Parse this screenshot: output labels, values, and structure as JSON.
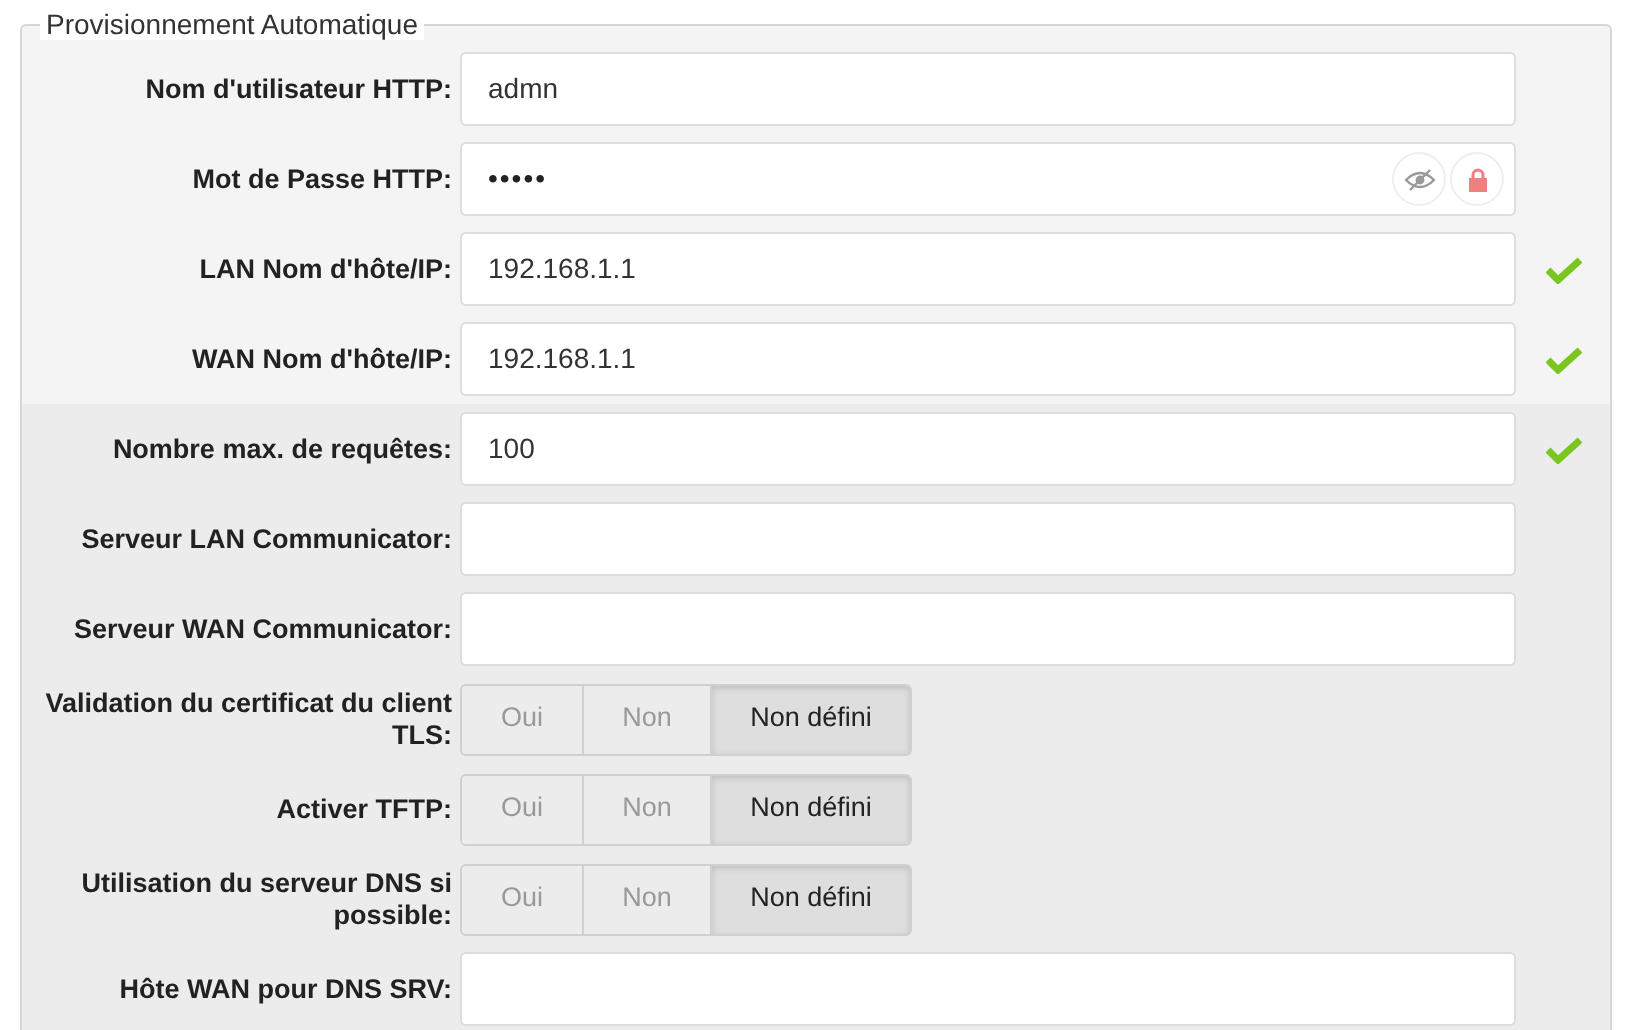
{
  "legend": "Provisionnement Automatique",
  "rows": [
    {
      "kind": "text",
      "label": "Nom d'utilisateur HTTP:",
      "value": "admn",
      "valid": false,
      "highlighted": false
    },
    {
      "kind": "password",
      "label": "Mot de Passe HTTP:",
      "value": "•••••",
      "valid": false,
      "highlighted": false
    },
    {
      "kind": "text",
      "label": "LAN Nom d'hôte/IP:",
      "value": "192.168.1.1",
      "valid": true,
      "highlighted": false
    },
    {
      "kind": "text",
      "label": "WAN Nom d'hôte/IP:",
      "value": "192.168.1.1",
      "valid": true,
      "highlighted": false
    },
    {
      "kind": "text",
      "label": "Nombre max. de requêtes:",
      "value": "100",
      "valid": true,
      "highlighted": true
    },
    {
      "kind": "text",
      "label": "Serveur LAN Communicator:",
      "valid": false,
      "highlighted": true
    },
    {
      "kind": "text",
      "label": "Serveur WAN Communicator:",
      "valid": false,
      "highlighted": true
    },
    {
      "kind": "toggle",
      "label": "Validation du certificat du client TLS:",
      "options": [
        {
          "label": "Oui",
          "selected": false
        },
        {
          "label": "Non",
          "selected": false
        },
        {
          "label": "Non défini",
          "selected": true
        }
      ],
      "highlighted": true
    },
    {
      "kind": "toggle",
      "label": "Activer TFTP:",
      "options": [
        {
          "label": "Oui",
          "selected": false
        },
        {
          "label": "Non",
          "selected": false
        },
        {
          "label": "Non défini",
          "selected": true
        }
      ],
      "highlighted": true
    },
    {
      "kind": "toggle",
      "label": "Utilisation du serveur DNS si possible:",
      "options": [
        {
          "label": "Oui",
          "selected": false
        },
        {
          "label": "Non",
          "selected": false
        },
        {
          "label": "Non défini",
          "selected": true
        }
      ],
      "highlighted": true
    },
    {
      "kind": "text",
      "label": "Hôte WAN pour DNS SRV:",
      "valid": false,
      "highlighted": true
    }
  ]
}
